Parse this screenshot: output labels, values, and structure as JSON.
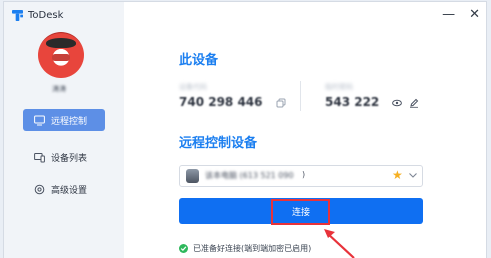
{
  "app": {
    "title": "ToDesk",
    "accent": "#1c7ff0"
  },
  "window_controls": {
    "minimize": "—",
    "close": "✕"
  },
  "sidebar": {
    "username": "涛涛",
    "items": [
      {
        "label": "远程控制",
        "icon": "monitor-remote-icon",
        "active": true
      },
      {
        "label": "设备列表",
        "icon": "devices-icon",
        "active": false
      },
      {
        "label": "高级设置",
        "icon": "settings-icon",
        "active": false
      }
    ]
  },
  "this_device": {
    "title": "此设备",
    "device_code_label": "设备代码",
    "device_code": "740 298 446",
    "temp_password_label": "临时密码",
    "temp_password": "543 222"
  },
  "remote": {
    "title": "远程控制设备",
    "selected_device": "该本电脑 (613 521 090",
    "selected_device_tail": ")",
    "connect_label": "连接",
    "status_text": "已准备好连接(端到端加密已启用)",
    "status_color": "#2eb85c"
  }
}
